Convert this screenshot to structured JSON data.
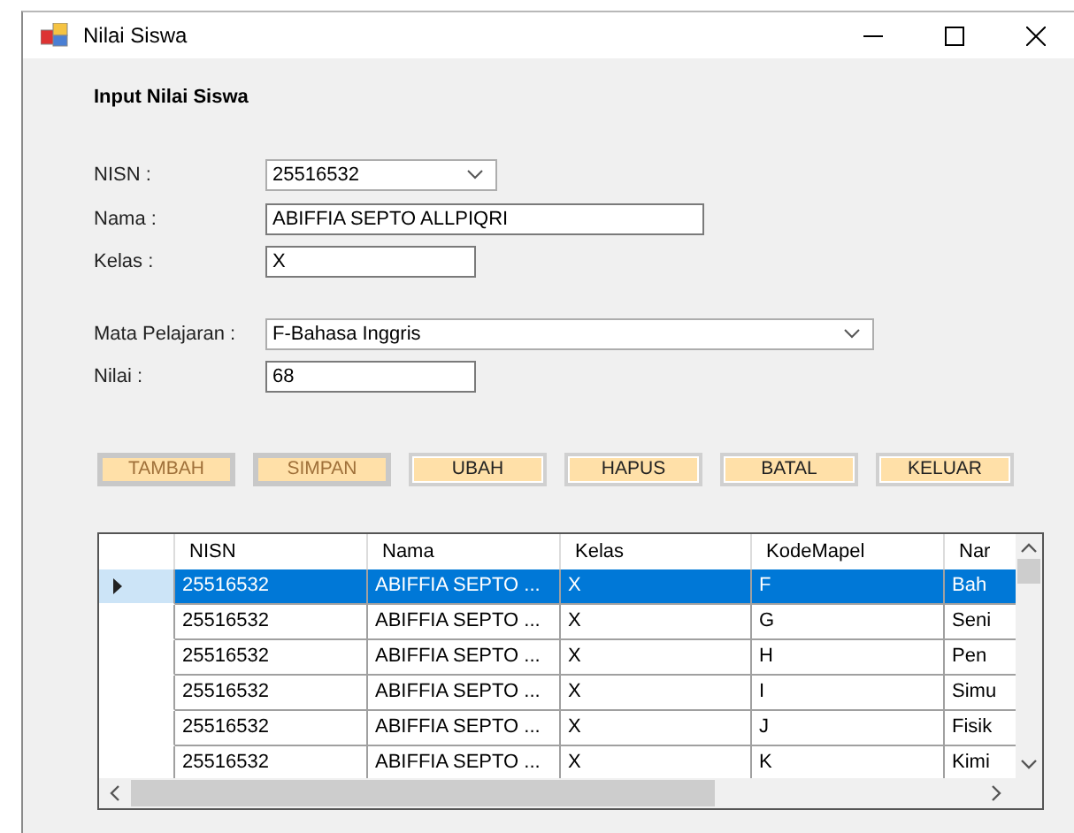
{
  "window": {
    "title": "Nilai Siswa"
  },
  "heading": "Input Nilai Siswa",
  "fields": [
    {
      "kind": "dropdown",
      "label": "NISN :",
      "value": "25516532"
    },
    {
      "kind": "text",
      "label": "Nama :",
      "value": "ABIFFIA SEPTO ALLPIQRI"
    },
    {
      "kind": "text",
      "label": "Kelas :",
      "value": "X"
    },
    {
      "kind": "dropdown",
      "label": "Mata Pelajaran :",
      "value": "F-Bahasa Inggris"
    },
    {
      "kind": "text",
      "label": "Nilai :",
      "value": "68"
    }
  ],
  "buttons": [
    {
      "label": "TAMBAH",
      "disabled": true
    },
    {
      "label": "SIMPAN",
      "disabled": true
    },
    {
      "label": "UBAH",
      "disabled": false
    },
    {
      "label": "HAPUS",
      "disabled": false
    },
    {
      "label": "BATAL",
      "disabled": false
    },
    {
      "label": "KELUAR",
      "disabled": false
    }
  ],
  "table": {
    "columns": [
      "NISN",
      "Nama",
      "Kelas",
      "KodeMapel",
      "Nar"
    ],
    "rows": [
      {
        "selected": true,
        "cells": [
          "25516532",
          "ABIFFIA SEPTO ...",
          "X",
          "F",
          "Bah"
        ]
      },
      {
        "selected": false,
        "cells": [
          "25516532",
          "ABIFFIA SEPTO ...",
          "X",
          "G",
          "Seni"
        ]
      },
      {
        "selected": false,
        "cells": [
          "25516532",
          "ABIFFIA SEPTO ...",
          "X",
          "H",
          "Pen"
        ]
      },
      {
        "selected": false,
        "cells": [
          "25516532",
          "ABIFFIA SEPTO ...",
          "X",
          "I",
          "Simu"
        ]
      },
      {
        "selected": false,
        "cells": [
          "25516532",
          "ABIFFIA SEPTO ...",
          "X",
          "J",
          "Fisik"
        ]
      },
      {
        "selected": false,
        "cells": [
          "25516532",
          "ABIFFIA SEPTO ...",
          "X",
          "K",
          "Kimi"
        ]
      }
    ]
  }
}
